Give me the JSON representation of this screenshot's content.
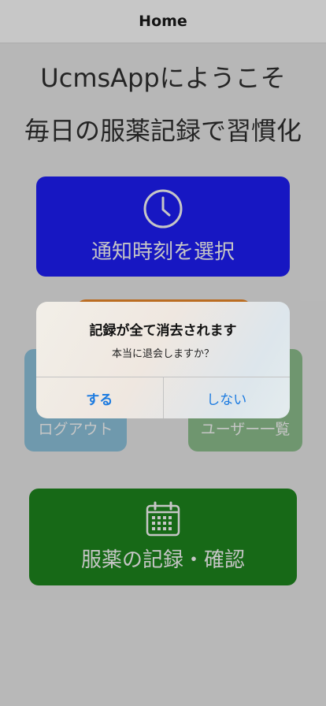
{
  "navbar": {
    "title": "Home"
  },
  "welcome": {
    "line1": "UcmsAppにようこそ",
    "line2": "毎日の服薬記録で習慣化"
  },
  "cards": {
    "notify_label": "通知時刻を選択",
    "logout_label": "ログアウト",
    "users_label": "ユーザー一覧",
    "record_label": "服薬の記録・確認"
  },
  "icons": {
    "notify": "clock-icon",
    "record": "calendar-icon"
  },
  "colors": {
    "notify_card": "#0000d1",
    "orange_card": "#c86a0e",
    "logout_card": "#6c9fb7",
    "users_card": "#6c9c6c",
    "record_card": "#006400",
    "alert_button": "#1b7ae0"
  },
  "alert": {
    "title": "記録が全て消去されます",
    "message": "本当に退会しますか？",
    "confirm_label": "する",
    "cancel_label": "しない"
  }
}
